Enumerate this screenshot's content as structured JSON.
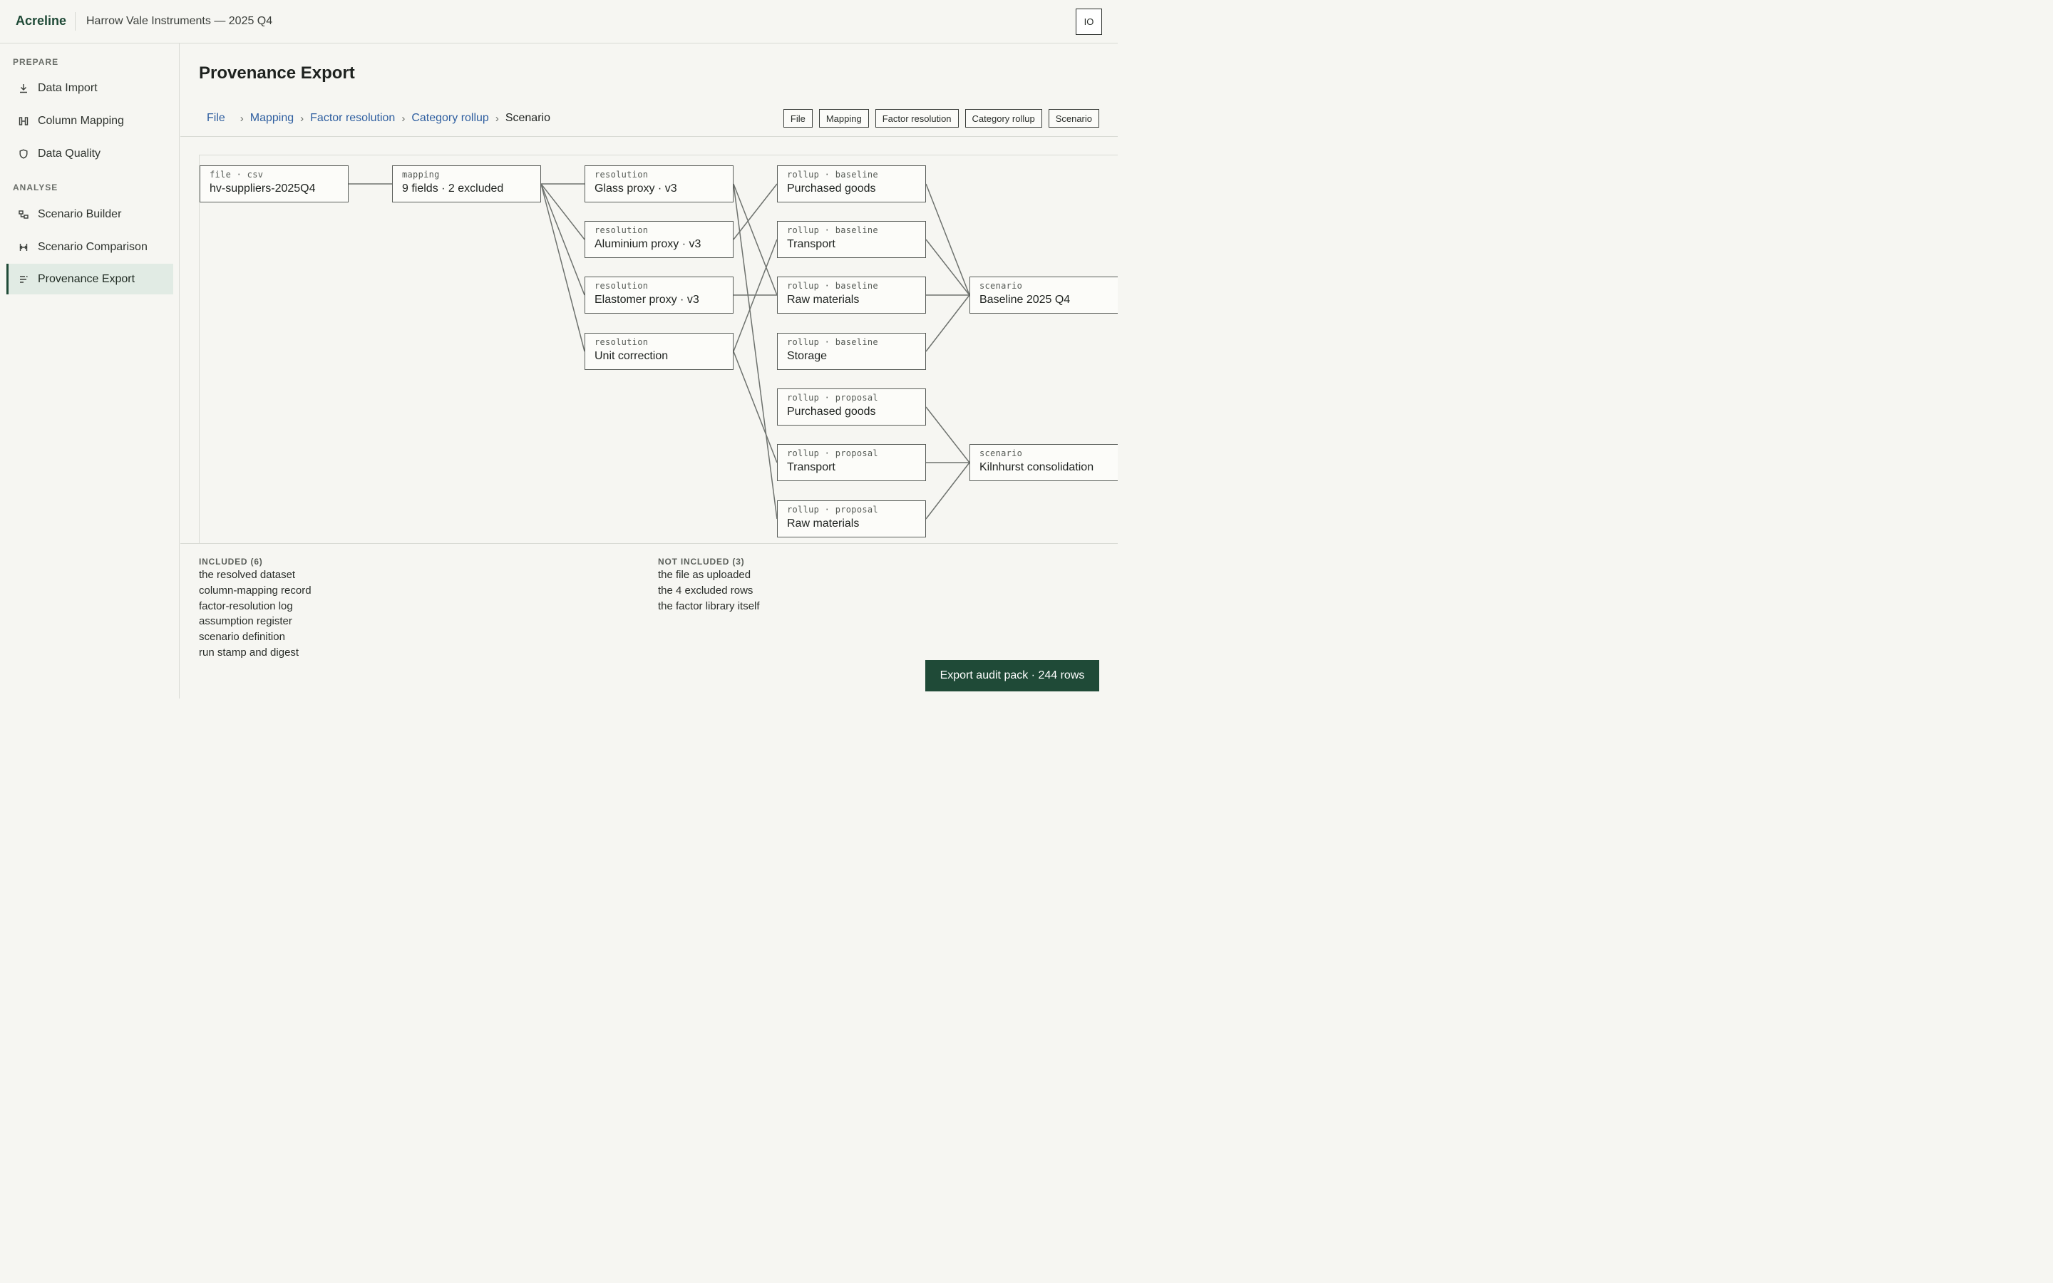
{
  "app": {
    "brand": "Acreline",
    "org": "Harrow Vale Instruments — 2025 Q4",
    "user_initials": "IO"
  },
  "sidebar": {
    "sections": [
      {
        "label": "PREPARE",
        "items": [
          {
            "label": "Data Import",
            "icon": "download-icon"
          },
          {
            "label": "Column Mapping",
            "icon": "columns-icon"
          },
          {
            "label": "Data Quality",
            "icon": "shield-icon"
          }
        ]
      },
      {
        "label": "ANALYSE",
        "items": [
          {
            "label": "Scenario Builder",
            "icon": "hierarchy-icon"
          },
          {
            "label": "Scenario Comparison",
            "icon": "compare-icon"
          },
          {
            "label": "Provenance Export",
            "icon": "list-icon",
            "active": true
          }
        ]
      }
    ]
  },
  "main": {
    "title": "Provenance Export",
    "breadcrumb": [
      "File",
      "Mapping",
      "Factor resolution",
      "Category rollup",
      "Scenario"
    ],
    "chips": [
      "File",
      "Mapping",
      "Factor resolution",
      "Category rollup",
      "Scenario"
    ]
  },
  "graph": {
    "nodes": [
      {
        "id": "file",
        "kind": "file · csv",
        "label": "hv-suppliers-2025Q4"
      },
      {
        "id": "map",
        "kind": "mapping",
        "label": "9 fields · 2 excluded"
      },
      {
        "id": "r1",
        "kind": "resolution",
        "label": "Glass proxy · v3"
      },
      {
        "id": "r2",
        "kind": "resolution",
        "label": "Aluminium proxy · v3"
      },
      {
        "id": "r3",
        "kind": "resolution",
        "label": "Elastomer proxy · v3"
      },
      {
        "id": "r4",
        "kind": "resolution",
        "label": "Unit correction"
      },
      {
        "id": "b1",
        "kind": "rollup · baseline",
        "label": "Purchased goods"
      },
      {
        "id": "b2",
        "kind": "rollup · baseline",
        "label": "Transport"
      },
      {
        "id": "b3",
        "kind": "rollup · baseline",
        "label": "Raw materials"
      },
      {
        "id": "b4",
        "kind": "rollup · baseline",
        "label": "Storage"
      },
      {
        "id": "p1",
        "kind": "rollup · proposal",
        "label": "Purchased goods"
      },
      {
        "id": "p2",
        "kind": "rollup · proposal",
        "label": "Transport"
      },
      {
        "id": "p3",
        "kind": "rollup · proposal",
        "label": "Raw materials"
      },
      {
        "id": "s1",
        "kind": "scenario",
        "label": "Baseline 2025 Q4"
      },
      {
        "id": "s2",
        "kind": "scenario",
        "label": "Kilnhurst consolidation"
      }
    ],
    "edges": [
      [
        "file",
        "map"
      ],
      [
        "map",
        "r1"
      ],
      [
        "map",
        "r2"
      ],
      [
        "map",
        "r3"
      ],
      [
        "map",
        "r4"
      ],
      [
        "r1",
        "b3"
      ],
      [
        "r1",
        "p3"
      ],
      [
        "r2",
        "b1"
      ],
      [
        "r3",
        "b3"
      ],
      [
        "r4",
        "b2"
      ],
      [
        "r4",
        "p2"
      ],
      [
        "b1",
        "s1"
      ],
      [
        "b2",
        "s1"
      ],
      [
        "b3",
        "s1"
      ],
      [
        "b4",
        "s1"
      ],
      [
        "p1",
        "s2"
      ],
      [
        "p2",
        "s2"
      ],
      [
        "p3",
        "s2"
      ]
    ]
  },
  "included": {
    "heading": "INCLUDED (6)",
    "items": [
      "the resolved dataset",
      "column-mapping record",
      "factor-resolution log",
      "assumption register",
      "scenario definition",
      "run stamp and digest"
    ]
  },
  "not_included": {
    "heading": "NOT INCLUDED (3)",
    "items": [
      "the file as uploaded",
      "the 4 excluded rows",
      "the factor library itself"
    ]
  },
  "export_button": "Export audit pack · 244 rows"
}
